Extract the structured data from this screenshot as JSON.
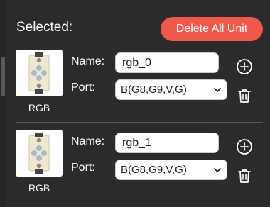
{
  "header": {
    "selected_label": "Selected:",
    "delete_all_label": "Delete All Unit"
  },
  "units": [
    {
      "type_label": "RGB",
      "name_label": "Name:",
      "name_value": "rgb_0",
      "port_label": "Port:",
      "port_value": "B(G8,G9,V,G)"
    },
    {
      "type_label": "RGB",
      "name_label": "Name:",
      "name_value": "rgb_1",
      "port_label": "Port:",
      "port_value": "B(G8,G9,V,G)"
    }
  ],
  "colors": {
    "background": "#2b2b2b",
    "accent": "#f0584a",
    "text": "#ffffff"
  }
}
